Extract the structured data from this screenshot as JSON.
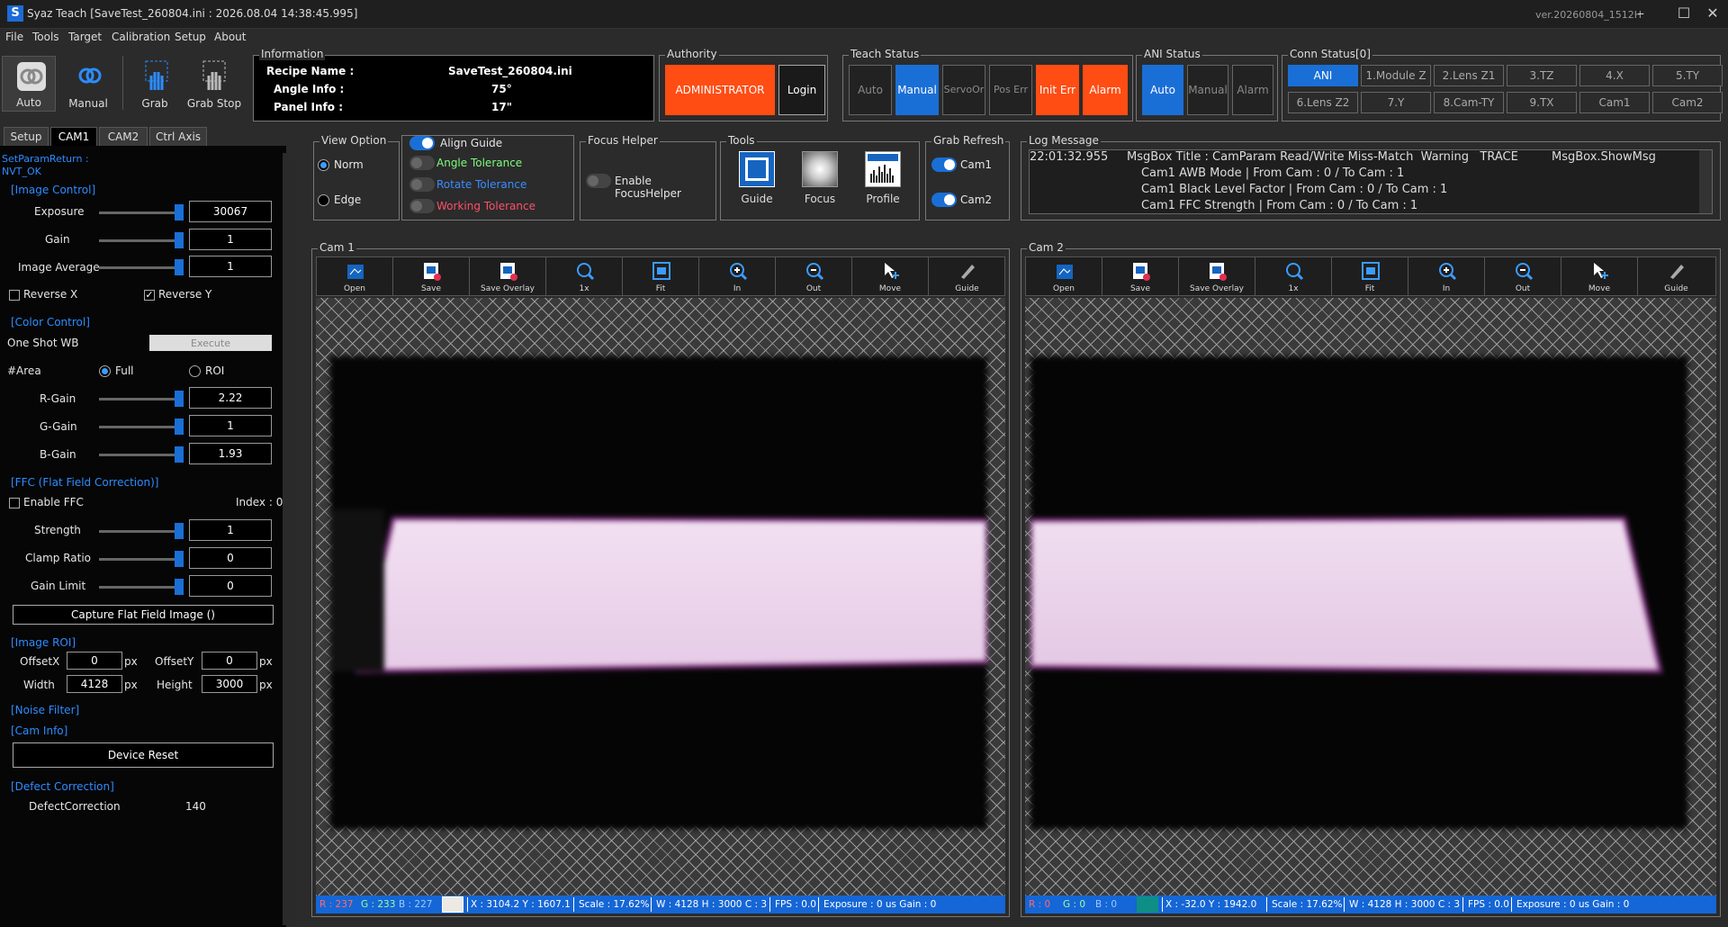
{
  "window": {
    "title": "Syaz Teach [SaveTest_260804.ini : 2026.08.04 14:38:45.995]",
    "logo": "S",
    "version": "ver.20260804_1512H",
    "minimize": "–",
    "maximize": "☐",
    "close": "✕"
  },
  "menu": [
    "File",
    "Tools",
    "Target",
    "Calibration",
    "Setup",
    "About"
  ],
  "toolbar": {
    "auto": "Auto",
    "manual": "Manual",
    "grab": "Grab",
    "grab_stop": "Grab Stop"
  },
  "information": {
    "title": "Information",
    "recipe_label": "Recipe Name :",
    "recipe_value": "SaveTest_260804.ini",
    "angle_label": "Angle Info :",
    "angle_value": "75°",
    "panel_label": "Panel Info :",
    "panel_value": "17\""
  },
  "authority": {
    "title": "Authority",
    "role": "ADMINISTRATOR",
    "login": "Login"
  },
  "teach_status": {
    "title": "Teach Status",
    "items": [
      "Auto",
      "Manual",
      "ServoOr",
      "Pos Err",
      "Init Err",
      "Alarm"
    ]
  },
  "ani_status": {
    "title": "ANI Status",
    "items": [
      "Auto",
      "Manual",
      "Alarm"
    ]
  },
  "conn_status": {
    "title": "Conn Status[0]",
    "row1": [
      "ANI",
      "1.Module Z",
      "2.Lens Z1",
      "3.TZ",
      "4.X",
      "5.TY"
    ],
    "row2": [
      "6.Lens Z2",
      "7.Y",
      "8.Cam-TY",
      "9.TX",
      "Cam1",
      "Cam2"
    ]
  },
  "tabs": [
    "Setup",
    "CAM1",
    "CAM2",
    "Ctrl Axis"
  ],
  "left": {
    "return_line1": "SetParamReturn :",
    "return_line2": "NVT_OK",
    "image_control": "[Image Control]",
    "exposure_label": "Exposure",
    "exposure_value": "30067",
    "gain_label": "Gain",
    "gain_value": "1",
    "avg_label": "Image Average",
    "avg_value": "1",
    "reverse_x": "Reverse X",
    "reverse_y": "Reverse Y",
    "color_control": "[Color Control]",
    "one_shot_wb": "One Shot WB",
    "execute": "Execute",
    "area_label": "#Area",
    "full": "Full",
    "roi": "ROI",
    "rgain_label": "R-Gain",
    "rgain_value": "2.22",
    "ggain_label": "G-Gain",
    "ggain_value": "1",
    "bgain_label": "B-Gain",
    "bgain_value": "1.93",
    "ffc_title": "[FFC (Flat Field Correction)]",
    "enable_ffc": "Enable FFC",
    "index": "Index : 0",
    "strength_label": "Strength",
    "strength_value": "1",
    "clamp_label": "Clamp Ratio",
    "clamp_value": "0",
    "gainlimit_label": "Gain Limit",
    "gainlimit_value": "0",
    "capture_ffc": "Capture Flat Field Image ()",
    "image_roi": "[Image ROI]",
    "offsetx_label": "OffsetX",
    "offsetx_value": "0",
    "offsety_label": "OffsetY",
    "offsety_value": "0",
    "width_label": "Width",
    "width_value": "4128",
    "height_label": "Height",
    "height_value": "3000",
    "px": "px",
    "noise_filter": "[Noise Filter]",
    "cam_info": "[Cam Info]",
    "device_reset": "Device Reset",
    "defect_title": "[Defect Correction]",
    "defect_label": "DefectCorrection",
    "defect_value": "140"
  },
  "view_option": {
    "title": "View Option",
    "norm": "Norm",
    "edge": "Edge"
  },
  "guides": {
    "align": "Align Guide",
    "angle": "Angle Tolerance",
    "rotate": "Rotate Tolerance",
    "working": "Working Tolerance"
  },
  "focus_helper": {
    "title": "Focus Helper",
    "enable": "Enable FocusHelper"
  },
  "tools": {
    "title": "Tools",
    "guide": "Guide",
    "focus": "Focus",
    "profile": "Profile"
  },
  "grab_refresh": {
    "title": "Grab Refresh",
    "cam1": "Cam1",
    "cam2": "Cam2"
  },
  "log": {
    "title": "Log Message",
    "lines": [
      "22:01:32.955     MsgBox Title : CamParam Read/Write Miss-Match  Warning   TRACE         MsgBox.ShowMsg",
      "                              Cam1 AWB Mode | From Cam : 0 / To Cam : 1",
      "                              Cam1 Black Level Factor | From Cam : 0 / To Cam : 1",
      "                              Cam1 FFC Strength | From Cam : 0 / To Cam : 1"
    ]
  },
  "cam_tools": [
    "Open",
    "Save",
    "Save Overlay",
    "1x",
    "Fit",
    "In",
    "Out",
    "Move",
    "Guide"
  ],
  "cam1": {
    "title": "Cam 1",
    "r": "R :  237",
    "g": "G :  233",
    "b": "B :  227",
    "swatch_color": "#EDE9E3",
    "xy": "X : 3104.2  Y : 1607.1",
    "scale": "Scale : 17.62%",
    "whc": "W : 4128  H : 3000  C : 3",
    "fps": "FPS : 0.0",
    "exp": "Exposure : 0 us  Gain : 0"
  },
  "cam2": {
    "title": "Cam 2",
    "r": "R :    0",
    "g": "G :    0",
    "b": "B :    0",
    "swatch_color": "#0E8F86",
    "xy": "X : -32.0  Y : 1942.0",
    "scale": "Scale : 17.62%",
    "whc": "W : 4128  H : 3000  C : 3",
    "fps": "FPS : 0.0",
    "exp": "Exposure : 0 us  Gain : 0"
  },
  "colors": {
    "accent_blue": "#1A6FD6",
    "alert_orange": "#FF4D14",
    "section_blue": "#2D8CFF",
    "angle_green": "#7CFC7C",
    "rotate_blue": "#3B8CFF",
    "working_red": "#FF4F6A"
  }
}
